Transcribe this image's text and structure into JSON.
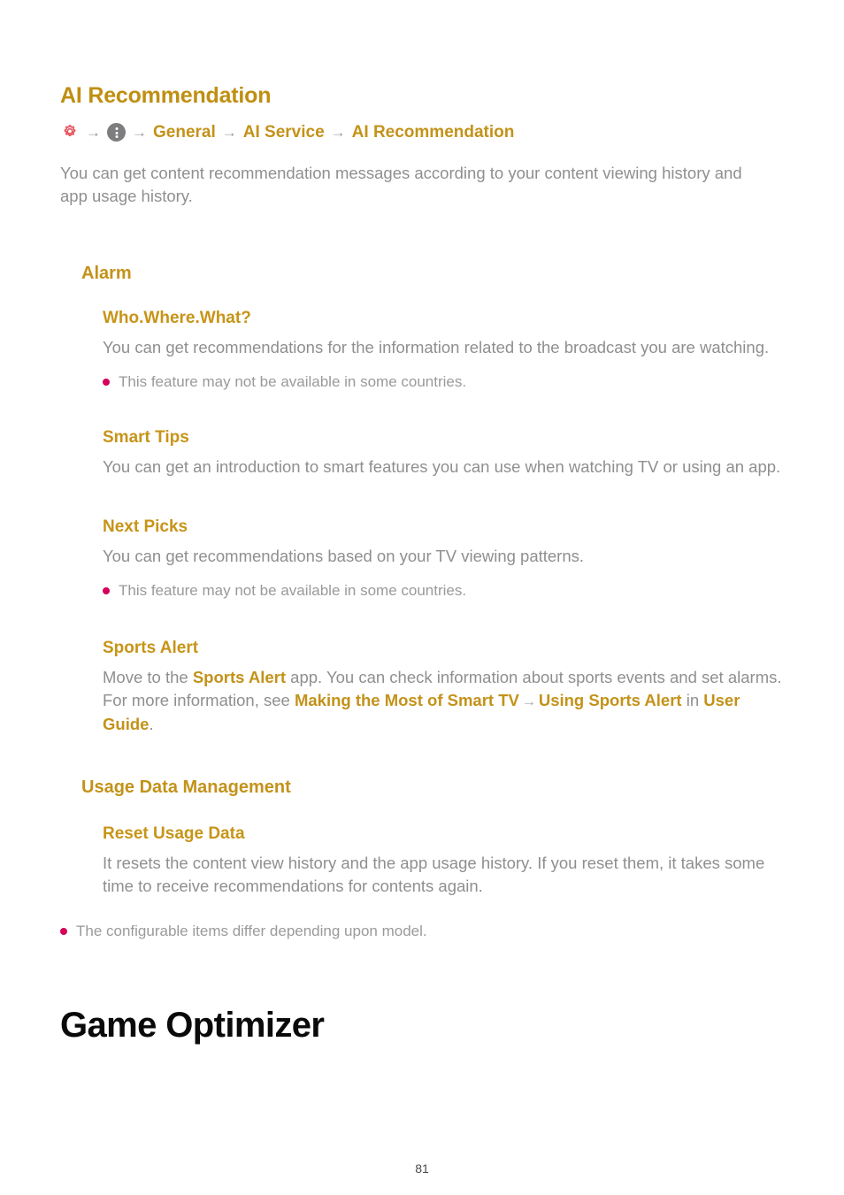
{
  "document": {
    "page_number": "81"
  },
  "section": {
    "title": "AI Recommendation",
    "breadcrumb": {
      "icon_settings": "gear-icon",
      "icon_more": "more-options-icon",
      "arrow": "→",
      "items": [
        "General",
        "AI Service",
        "AI Recommendation"
      ]
    },
    "intro": "You can get content recommendation messages according to your content viewing history and app usage history."
  },
  "alarm": {
    "heading": "Alarm",
    "items": [
      {
        "heading": "Who.Where.What?",
        "body": "You can get recommendations for the information related to the broadcast you are watching.",
        "note": "This feature may not be available in some countries."
      },
      {
        "heading": "Smart Tips",
        "body": "You can get an introduction to smart features you can use when watching TV or using an app.",
        "note": ""
      },
      {
        "heading": "Next Picks",
        "body": "You can get recommendations based on your TV viewing patterns.",
        "note": "This feature may not be available in some countries."
      }
    ],
    "sports_alert": {
      "heading": "Sports Alert",
      "line1_prefix": "Move to the ",
      "line1_bold": "Sports Alert",
      "line1_suffix": " app. You can check information about sports events and set alarms.",
      "line2_prefix": "For more information, see ",
      "line2_bold1": "Making the Most of Smart TV",
      "line2_arrow": "→",
      "line2_bold2": "Using Sports Alert",
      "line2_mid": " in ",
      "line2_bold3": "User Guide",
      "line2_suffix": "."
    }
  },
  "usage_data": {
    "heading": "Usage Data Management",
    "reset": {
      "heading": "Reset Usage Data",
      "body": "It resets the content view history and the app usage history. If you reset them, it takes some time to receive recommendations for contents again."
    }
  },
  "footer_note": "The configurable items differ depending upon model.",
  "next_chapter": {
    "title": "Game Optimizer"
  },
  "colors": {
    "heading_gold": "#bf8f12",
    "body_gray": "#8f8f8f",
    "bullet_magenta": "#d4005a",
    "gear_red": "#e8515a",
    "dots_gray": "#7d7d80",
    "chapter_black": "#0a0a0a"
  }
}
